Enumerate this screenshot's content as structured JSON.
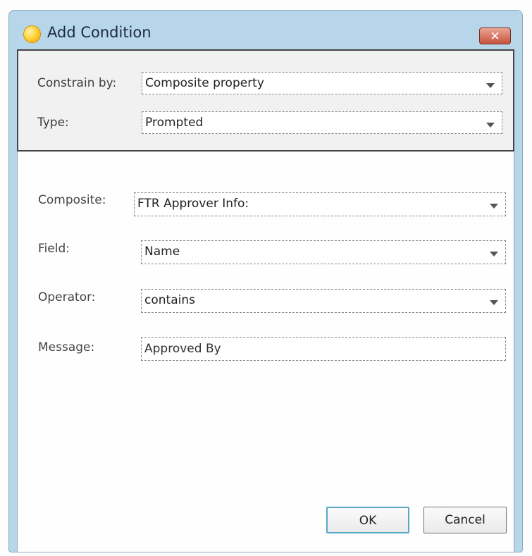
{
  "window": {
    "title": "Add Condition",
    "close_glyph": "✕",
    "icon": "app-orb-icon"
  },
  "form": {
    "constrain_by": {
      "label": "Constrain by:",
      "value": "Composite property"
    },
    "type": {
      "label": "Type:",
      "value": "Prompted"
    },
    "composite": {
      "label": "Composite:",
      "value": "FTR Approver Info:"
    },
    "field": {
      "label": "Field:",
      "value": "Name"
    },
    "operator": {
      "label": "Operator:",
      "value": "contains"
    },
    "message": {
      "label": "Message:",
      "value": "Approved By"
    }
  },
  "buttons": {
    "ok": "OK",
    "cancel": "Cancel"
  },
  "colors": {
    "titlebar": "#b8d6ea",
    "ok_border": "#59a8c8",
    "panel": "#f1f1f1"
  }
}
